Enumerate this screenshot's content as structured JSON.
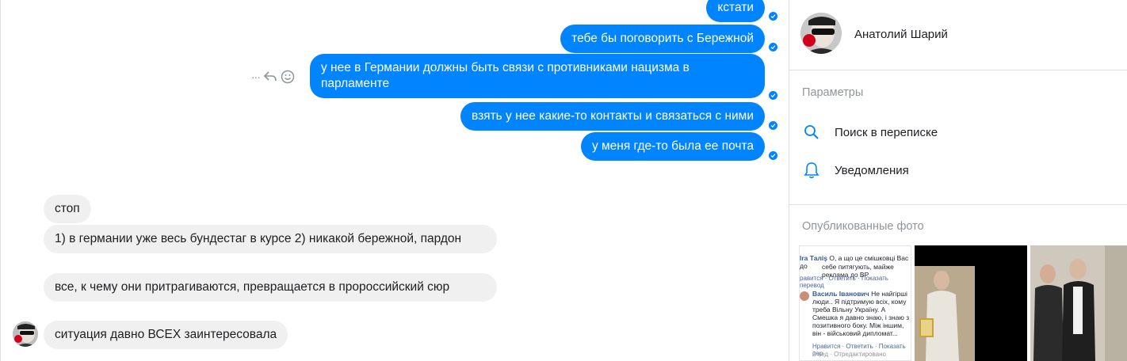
{
  "outgoing": [
    {
      "text": "кстати"
    },
    {
      "text": "тебе бы поговорить с Бережной"
    },
    {
      "text": "у нее в Германии должны быть связи с противниками нацизма в парламенте"
    },
    {
      "text": "взять у нее какие-то контакты и связаться с ними"
    },
    {
      "text": "у меня где-то была ее почта"
    }
  ],
  "incoming": [
    {
      "text": "стоп"
    },
    {
      "text": "1) в германии уже весь бундестаг в курсе 2) никакой бережной, пардон"
    },
    {
      "text": "все, к чему они притрагиваются, превращается в пророссийский сюр"
    },
    {
      "text": "ситуация давно ВСЕХ заинтересовала"
    }
  ],
  "actions": {
    "more": "···",
    "reply_icon": "reply-icon",
    "react_icon": "emoji-icon"
  },
  "sidebar": {
    "profile_name": "Анатолий Шарий",
    "params_title": "Параметры",
    "search_label": "Поиск в переписке",
    "notifications_label": "Уведомления",
    "photos_title": "Опубликованные фото",
    "photo1": {
      "line1_name": "Ira Таліş",
      "line1": "О, а що це смішковці Вас до",
      "line2": "себе питягують, майже реклама до ВР",
      "links1": "равится · Ответить · Показать перевод",
      "name2": "Василь Іванович",
      "p1": "Не найгірші",
      "p2": "люди.. Я підтримую всіх, кому",
      "p3": "треба Вільну Україну. А",
      "p4": "Смешка я давно знаю, і знаю з",
      "p5": "позитивного боку. Між іншим,",
      "p6": "він - військовий дипломат...",
      "links2": "Нравится · Ответить · Показать пер",
      "links3": "2 нед · Отредактировано"
    }
  },
  "colors": {
    "accent": "#0084ff",
    "incoming_bg": "#f1f0f0",
    "muted": "#90949c"
  }
}
